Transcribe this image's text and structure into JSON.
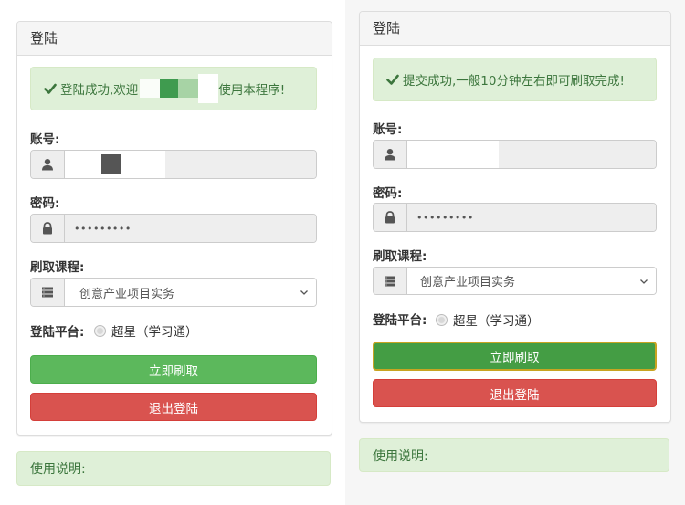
{
  "left": {
    "panel_title": "登陆",
    "alert_prefix": "登陆成功,欢迎",
    "alert_suffix": "使用本程序!",
    "account_label": "账号:",
    "password_label": "密码:",
    "password_value": "•••••••••",
    "course_label": "刷取课程:",
    "course_selected": "创意产业项目实务",
    "platform_label": "登陆平台:",
    "platform_option": "超星（学习通）",
    "start_button": "立即刷取",
    "logout_button": "退出登陆",
    "instructions_title": "使用说明:"
  },
  "right": {
    "panel_title": "登陆",
    "alert_text": "提交成功,一般10分钟左右即可刷取完成!",
    "account_label": "账号:",
    "password_label": "密码:",
    "password_value": "•••••••••",
    "course_label": "刷取课程:",
    "course_selected": "创意产业项目实务",
    "platform_label": "登陆平台:",
    "platform_option": "超星（学习通）",
    "start_button": "立即刷取",
    "logout_button": "退出登陆",
    "instructions_title": "使用说明:"
  },
  "colors": {
    "success_bg": "#dff0d8",
    "success_text": "#3c763d",
    "primary_green": "#5cb85c",
    "active_green": "#449d44",
    "danger_red": "#d9534f"
  },
  "icons": [
    "check-icon",
    "user-icon",
    "lock-icon",
    "list-icon",
    "chevron-down-icon"
  ]
}
